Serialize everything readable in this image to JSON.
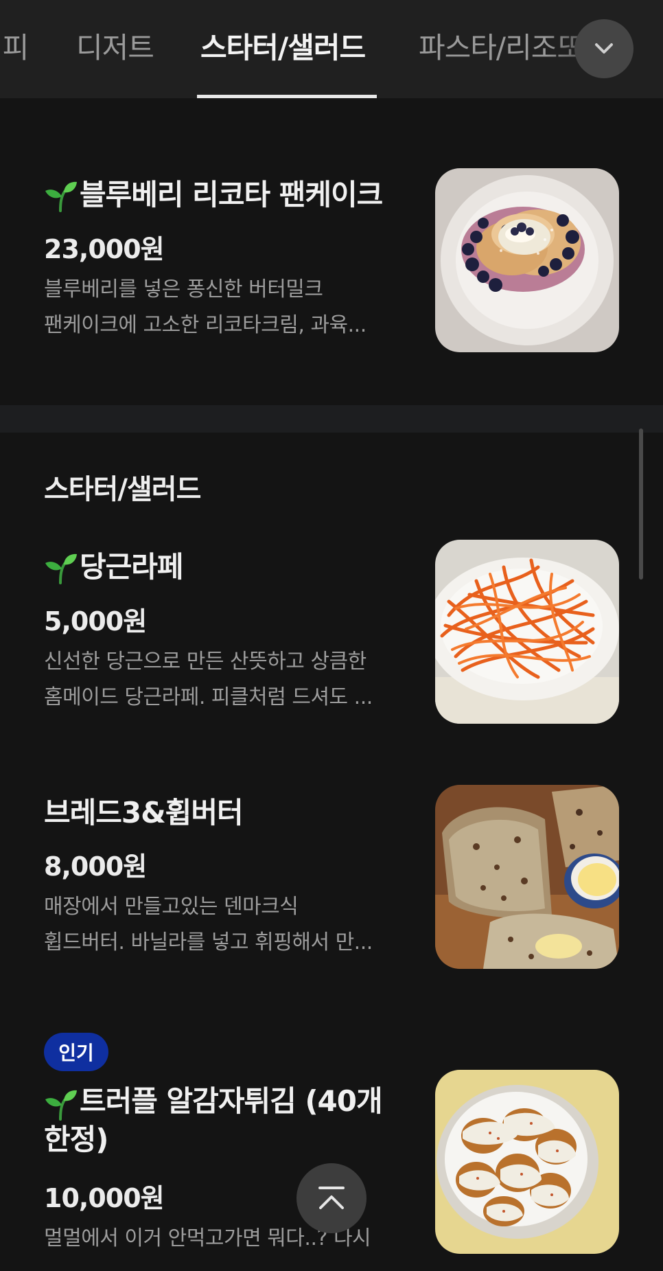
{
  "tabs": {
    "items": [
      {
        "label": "커피"
      },
      {
        "label": "디저트"
      },
      {
        "label": "스타터/샐러드"
      },
      {
        "label": "파스타/리조또"
      }
    ],
    "active_index": 2
  },
  "sections": [
    {
      "items": [
        {
          "vegan_icon": "sprout-icon",
          "name": "블루베리 리코타 팬케이크",
          "price": "23,000원",
          "description_lines": [
            "블루베리를 넣은 퐁신한 버터밀크",
            "팬케이크에 고소한 리코타크림, 과육..."
          ]
        }
      ]
    },
    {
      "title": "스타터/샐러드",
      "items": [
        {
          "vegan_icon": "sprout-icon",
          "name": "당근라페",
          "price": "5,000원",
          "description_lines": [
            "신선한 당근으로 만든 산뜻하고 상큼한",
            "홈메이드 당근라페. 피클처럼 드셔도 ..."
          ]
        },
        {
          "name": "브레드3&휩버터",
          "price": "8,000원",
          "description_lines": [
            "매장에서 만들고있는 덴마크식",
            "휩드버터. 바닐라를 넣고 휘핑해서 만..."
          ]
        },
        {
          "badge": "인기",
          "vegan_icon": "sprout-icon",
          "name_lines": [
            "트러플 알감자튀김 (40개",
            "한정)"
          ],
          "price": "10,000원",
          "description_lines": [
            "멀멀에서 이거 안먹고가면 뭐다..? 다시"
          ]
        }
      ]
    }
  ],
  "colors": {
    "background": "#141414",
    "tabbar": "#202020",
    "badge": "#0f2fa0",
    "sprout_green": "#3cae3f"
  }
}
